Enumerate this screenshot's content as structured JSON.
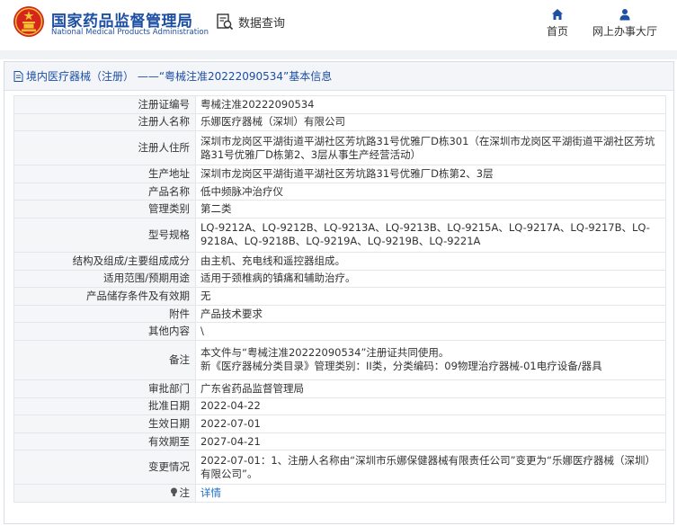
{
  "header": {
    "brand_cn": "国家药品监督管理局",
    "brand_en": "National Medical Products Administration",
    "search_label": "数据查询",
    "nav": [
      {
        "label": "首页",
        "icon": "home-icon"
      },
      {
        "label": "网上办事大厅",
        "icon": "user-icon"
      }
    ]
  },
  "colors": {
    "brand_blue": "#1d4fa2",
    "link_blue": "#1d6ec8",
    "logo_red": "#d6251d",
    "logo_gold": "#f2c230",
    "label_bg": "#f5f6f8"
  },
  "panel": {
    "title": "境内医疗器械（注册） ——“粤械注准20222090534”基本信息"
  },
  "rows": [
    {
      "label": "注册证编号",
      "value": "粤械注准20222090534"
    },
    {
      "label": "注册人名称",
      "value": "乐娜医疗器械（深圳）有限公司"
    },
    {
      "label": "注册人住所",
      "value": "深圳市龙岗区平湖街道平湖社区芳坑路31号优雅厂D栋301（在深圳市龙岗区平湖街道平湖社区芳坑路31号优雅厂D栋第2、3层从事生产经营活动）"
    },
    {
      "label": "生产地址",
      "value": "深圳市龙岗区平湖街道平湖社区芳坑路31号优雅厂D栋第2、3层"
    },
    {
      "label": "产品名称",
      "value": "低中频脉冲治疗仪"
    },
    {
      "label": "管理类别",
      "value": "第二类"
    },
    {
      "label": "型号规格",
      "value": "LQ-9212A、LQ-9212B、LQ-9213A、LQ-9213B、LQ-9215A、LQ-9217A、LQ-9217B、LQ-9218A、LQ-9218B、LQ-9219A、LQ-9219B、LQ-9221A"
    },
    {
      "label": "结构及组成/主要组成成分",
      "value": "由主机、充电线和遥控器组成。"
    },
    {
      "label": "适用范围/预期用途",
      "value": "适用于颈椎病的镇痛和辅助治疗。"
    },
    {
      "label": "产品储存条件及有效期",
      "value": "无"
    },
    {
      "label": "附件",
      "value": "产品技术要求"
    },
    {
      "label": "其他内容",
      "value": "\\"
    },
    {
      "label": "备注",
      "value": "本文件与“粤械注准20222090534”注册证共同使用。",
      "value2": "新《医疗器械分类目录》管理类别：II类，分类编码：09物理治疗器械-01电疗设备/器具"
    },
    {
      "label": "审批部门",
      "value": "广东省药品监督管理局"
    },
    {
      "label": "批准日期",
      "value": "2022-04-22"
    },
    {
      "label": "生效日期",
      "value": "2022-07-01"
    },
    {
      "label": "有效期至",
      "value": "2027-04-21"
    },
    {
      "label": "变更情况",
      "value": "2022-07-01：1、注册人名称由“深圳市乐娜保健器械有限责任公司”变更为“乐娜医疗器械（深圳）有限公司”。"
    },
    {
      "label": "注",
      "label_icon": "bulb-icon",
      "value": "详情"
    }
  ]
}
